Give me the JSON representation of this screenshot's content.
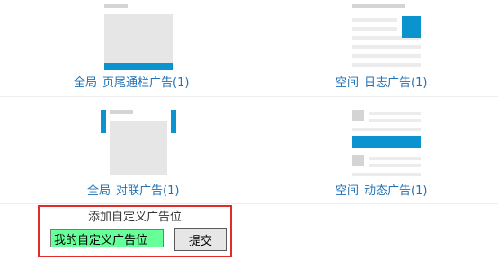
{
  "ad_options": [
    {
      "scope": "全局",
      "name": "页尾通栏广告(1)"
    },
    {
      "scope": "空间",
      "name": "日志广告(1)"
    },
    {
      "scope": "全局",
      "name": "对联广告(1)"
    },
    {
      "scope": "空间",
      "name": "动态广告(1)"
    }
  ],
  "custom_ad": {
    "title": "添加自定义广告位",
    "input_value": "我的自定义广告位",
    "submit_label": "提交"
  },
  "colors": {
    "accent_blue": "#0b93cf",
    "link_blue": "#1f72b5",
    "highlight_border": "#e22b2b",
    "input_bg": "#66ff99"
  }
}
